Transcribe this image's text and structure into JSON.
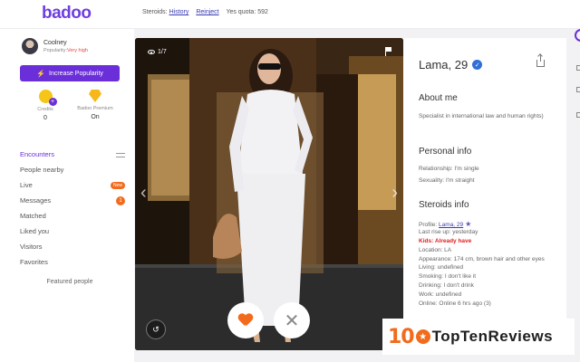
{
  "app": {
    "logo": "badoo"
  },
  "steroids_bar": {
    "label": "Steroids:",
    "history_link": "History",
    "reinject_link": "Reinject",
    "quota": "Yes quota: 592"
  },
  "user": {
    "name": "Coolney",
    "popularity_label": "Popularity:",
    "popularity_value": "Very high"
  },
  "increase_button": "Increase Popularity",
  "credits": {
    "label": "Credits",
    "value": "0"
  },
  "premium": {
    "label": "Badoo Premium",
    "value": "On"
  },
  "nav": [
    {
      "label": "Encounters"
    },
    {
      "label": "People nearby"
    },
    {
      "label": "Live",
      "badge": "New"
    },
    {
      "label": "Messages",
      "badge": "1"
    },
    {
      "label": "Matched"
    },
    {
      "label": "Liked you"
    },
    {
      "label": "Visitors"
    },
    {
      "label": "Favorites"
    }
  ],
  "featured": "Featured people",
  "photo": {
    "counter": "1/7"
  },
  "profile": {
    "name": "Lama, 29",
    "about_title": "About me",
    "about_text": "Specialist in international law and human rights)",
    "personal_title": "Personal info",
    "relationship": "Relationship: I'm single",
    "sexuality": "Sexuality: I'm straight",
    "steroids_title": "Steroids info",
    "profile_label": "Profile:",
    "profile_link": "Lama, 29",
    "last_rise": "Last rise up: yesterday",
    "kids": "Kids: Already have",
    "location": "Location: LA",
    "appearance": "Appearance: 174 cm, brown hair and other eyes",
    "living": "Living: undefined",
    "smoking": "Smoking: I don't like it",
    "drinking": "Drinking: I don't drink",
    "work": "Work: undefined",
    "online": "Online: Online 6 hrs ago (3)"
  },
  "watermark": {
    "ten": "10",
    "rest": "TopTenReviews"
  },
  "colors": {
    "brand": "#6a2fd8",
    "accent": "#f26b1d",
    "link": "#3b3bb3",
    "alert": "#e02020"
  }
}
